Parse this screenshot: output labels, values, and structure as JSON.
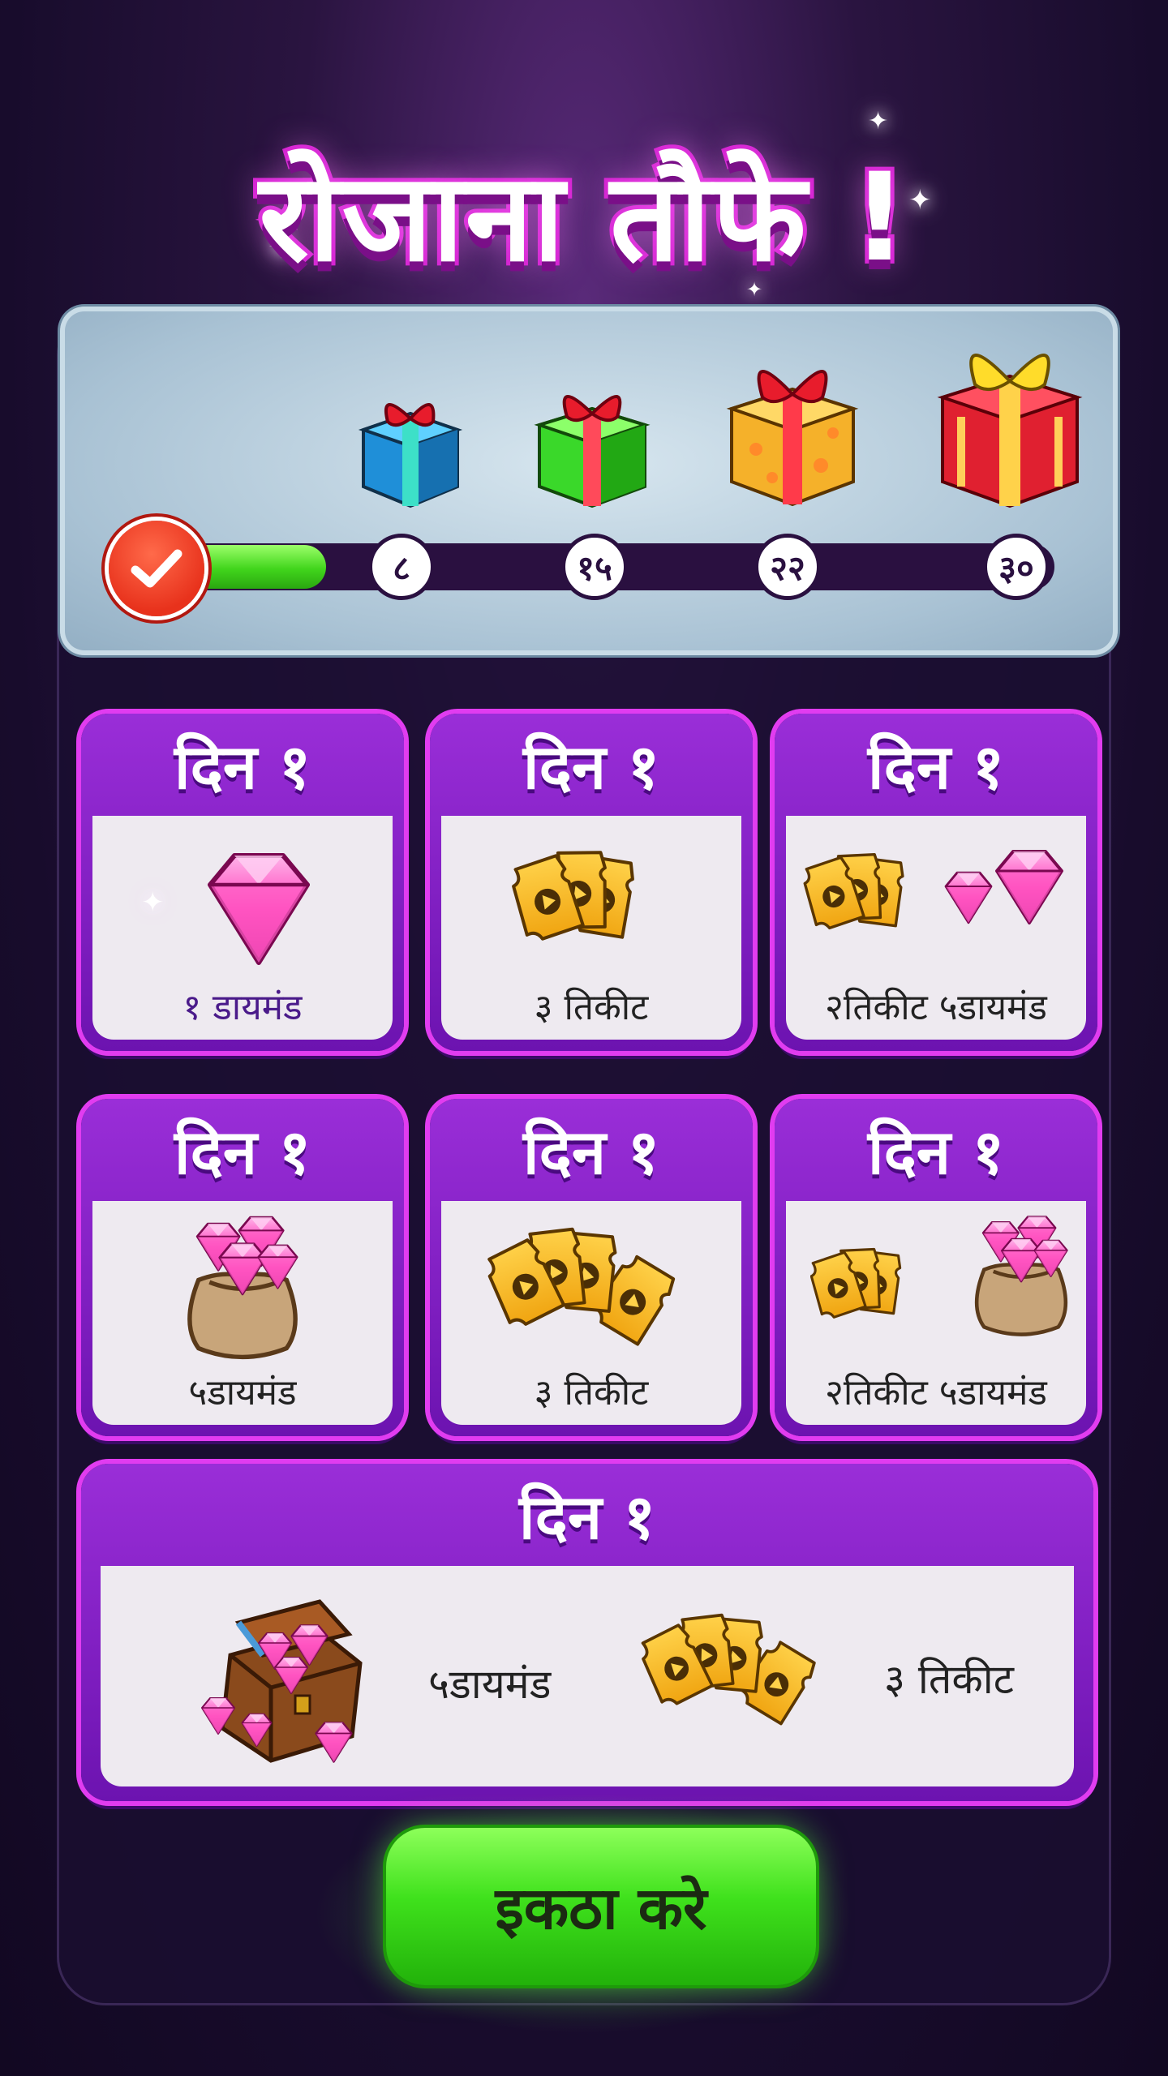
{
  "title": "रोजाना तौफे !",
  "progress": {
    "milestones": [
      "८",
      "१५",
      "२२",
      "३०"
    ],
    "completed_icon": "check-icon",
    "progress_fraction": 0.15
  },
  "cards": [
    {
      "day": "दिन १",
      "label": "१ डायमंड",
      "icon": "diamond-icon"
    },
    {
      "day": "दिन १",
      "label": "३ तिकीट",
      "icon": "tickets-icon"
    },
    {
      "day": "दिन १",
      "label": "२तिकीट ५डायमंड",
      "icon": "tickets-diamonds-icon"
    },
    {
      "day": "दिन १",
      "label": "५डायमंड",
      "icon": "diamond-sack-icon"
    },
    {
      "day": "दिन १",
      "label": "३ तिकीट",
      "icon": "tickets-icon"
    },
    {
      "day": "दिन १",
      "label": "२तिकीट ५डायमंड",
      "icon": "tickets-sack-icon"
    }
  ],
  "wide_card": {
    "day": "दिन १",
    "label_diamonds": "५डायमंड",
    "label_tickets": "३ तिकीट"
  },
  "collect_button": "इकठा करे",
  "colors": {
    "card_border": "#e13cf0",
    "card_header": "#8a22d0",
    "progress_fill": "#41d51c",
    "button": "#3fe11c"
  }
}
